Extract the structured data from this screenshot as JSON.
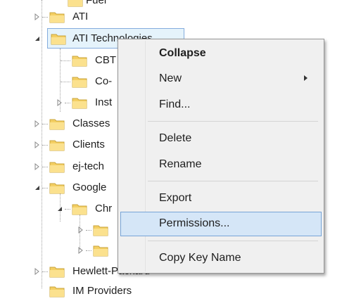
{
  "tree": {
    "items": [
      {
        "label": "Fuel",
        "expander": "none"
      },
      {
        "label": "ATI",
        "expander": "collapsed"
      },
      {
        "label": "ATI Technologies",
        "expander": "expanded"
      },
      {
        "label": "CBT",
        "expander": "none"
      },
      {
        "label": "Co-",
        "expander": "none"
      },
      {
        "label": "Inst",
        "expander": "collapsed"
      },
      {
        "label": "Classes",
        "expander": "collapsed"
      },
      {
        "label": "Clients",
        "expander": "collapsed"
      },
      {
        "label": "ej-tech",
        "expander": "collapsed"
      },
      {
        "label": "Google",
        "expander": "expanded"
      },
      {
        "label": "Chr",
        "expander": "expanded"
      },
      {
        "label": "",
        "expander": "collapsed"
      },
      {
        "label": "",
        "expander": "collapsed"
      },
      {
        "label": "Hewlett-Packard",
        "expander": "collapsed"
      },
      {
        "label": "IM Providers",
        "expander": "none"
      }
    ]
  },
  "context_menu": {
    "items": [
      {
        "label": "Collapse",
        "bold": true
      },
      {
        "label": "New",
        "has_submenu": true
      },
      {
        "label": "Find..."
      },
      {
        "label": "Delete"
      },
      {
        "label": "Rename"
      },
      {
        "label": "Export"
      },
      {
        "label": "Permissions...",
        "highlighted": true
      },
      {
        "label": "Copy Key Name"
      }
    ]
  },
  "colors": {
    "selection_bg": "#e5f3fb",
    "selection_border": "#84acdd",
    "menu_bg": "#f0f0f0",
    "menu_highlight_bg": "#d5e6f7",
    "menu_highlight_border": "#77a4d6",
    "folder_yellow": "#f4cf63"
  }
}
